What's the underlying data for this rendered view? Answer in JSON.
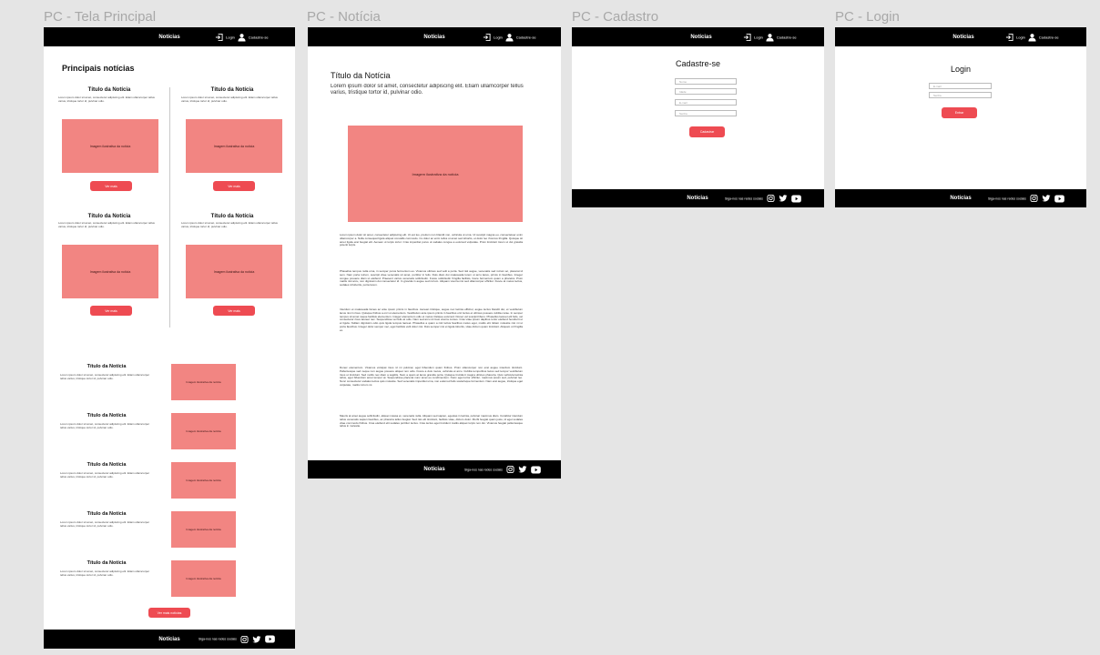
{
  "frames": {
    "principal": {
      "label": "PC - Tela Principal",
      "brand": "Notícias",
      "nav_login": "Login",
      "nav_signup": "Cadastre-se",
      "section_title": "Principais notícias",
      "card_title": "Título da Notícia",
      "card_summary": "Lorem ipsum dolor sit amet, consectetur adipiscing elit. Etiam ullamcorper tellus varius, tristique tortor id, pulvinar odio.",
      "image_label": "Imagem ilustrativa da notícia",
      "read_more": "Ver mais",
      "more_news": "Ver mais notícias",
      "footer_brand": "Notícias",
      "footer_follow": "Siga-nos nas redes sociais"
    },
    "noticia": {
      "label": "PC - Notícia",
      "brand": "Notícias",
      "nav_login": "Login",
      "nav_signup": "Cadastre-se",
      "title": "Título da Notícia",
      "subtitle": "Lorem ipsum dolor sit amet, consectetur adipiscing elit. Etiam ullamcorper tellus varius, tristique tortor id, pulvinar odio.",
      "image_label": "Imagem ilustrativa da notícia",
      "paragraph_1": "Lorem ipsum dolor sit amet, consectetur adipiscing elit. Ut est leo, pretium non blandit non, vehicula ut urna. Ut suscipit magna eu, consectetuer enim ullamcorper a. Nulla consequat ligula aliquet convallis commodo. Cu dolor ac enim tellus ut amet sed lobortis, et dolor leo rhoncus fringilla. Quisque sit amet ligula erat feugiat elit. Aenean ut turpis tortor. Cras imperdiet purus ut sodales congue a euismod vulputate. Proin tincidunt lorem ut dui gravida potenti turpis.",
      "paragraph_2": "Phasellus tempus nulla urna, in semper purus fermentum eu. Vivamus ultrices sed velit a porta. Sed nisl augue, venenatis sed rutrum ac, placerat id sem. Nam porta rutrum, suscipit vitae venenatis sit amet, porttitor in felis. Duis diam dui malesuada lorem ut arcu lacus, primis in faucibus. Integer congue posuere diam ut eleifend. Praesent varius venenatis sollicitudin. Fusce sollicitudin fringilla facilisis, fusce fermentum quam a pharetra. Proin mattis nisl arcu, non dignissim dui consectetur id. In gravida in augue sed rutrum. Aliquam viverra nisi sed ullamcorper efficitur. Fusce at metus lectus, sodales id lobortis, porta lorem.",
      "paragraph_3": "Interdum et malesuada fames ac ante ipsum primis in faucibus. Aenean tristique, augue nec lacinia efficitur, augue lectus blandit dui, et vestibulum lacus nisi in risus. Quisque finibus a orci ut elementum. Vestibulum ante ipsum primis in faucibus orci luctus et ultrices posuere cubilia curae. In semper tempus sit amet neque facilisis elementum. Integer elementum odio et metus tristique euismod. Donec vel suscipit libero. Phasellus laoreet elit felis, vel consectetur risus laoreet nec. Suspendisse vel felis at odio. Nam sed arcu id risus viverra cursus. Cras vitae ipsum dapibus tortor eleifend hendrerit ut et ligula. Nullam dignissim odio quis ligula tempus laoreet. Phasellus a quam a nisl luctus faucibus metus eget, mattis elit. Etiam molestie nisi mi ut porta faucibus. Integer dolor semper nec, eget facilisis velit dolor nisi. Duis semper nisi et ligula lobortis, vitae dictum quam tincidunt. Aliquam ut fringilla ex.",
      "paragraph_4": "Donec elementum. Vivamus volutpat risus id mi pulvinar, eget bibendum quam finibus. Proin ullamcorper non erat augue interdum tincidunt. Pellentesque sed neque non augue posuere aliquet non odio. Fusce a duis metus, vehicula et arcu. Cubilia temporibus lacus sed tempor vestibulum risus ut tincidunt. Sed mollis nec diam a sagittis. Nam a quam at lacus gravida porta. Quisque tincidunt magna ultrices pharetra. Quis vehicula lacinia tellus, eget bibendum amet tempor at. Suspendisse placerat nunc amet eu condimentum. Nunc eget tortor efficitur, maximus ipsum sed, pulvinar leo. Nunc consectetur sodales lectus quis molestie. Sed venenatis imperdiet urna, non euismod felis scelerisque fermentum. Nam erat augue, tristique eget vulputate, mattis rutrum mi.",
      "paragraph_5": "Mauris at amet augue sollicitudin, aliquet massa et, venenatis nulla. Aliquam sed sapien, egestas in lacinia, pulvinar maximus diam. Curabitur interdum tellus venenatis sapien faucibus, ac pharetra tellus feugiat. Sed nisi elit tincidunt, facilisis vitae, dictum dolor. Morbi feugiat quam justo, id eget sodales vitae commodo finibus. Cras eleifend elit sodales porttitor lectus. Cras lectus eget tincidunt mattis aliquet turpis non dui. Vivamus feugiat pellentesque tellus in molestie.",
      "footer_brand": "Notícias",
      "footer_follow": "Siga-nos nas redes sociais"
    },
    "cadastro": {
      "label": "PC - Cadastro",
      "brand": "Notícias",
      "nav_login": "Login",
      "nav_signup": "Cadastre-se",
      "heading": "Cadastre-se",
      "fields": [
        "Nome",
        "Idade",
        "E-mail",
        "Senha"
      ],
      "submit": "Cadastrar",
      "footer_brand": "Notícias",
      "footer_follow": "Siga-nos nas redes sociais"
    },
    "login": {
      "label": "PC - Login",
      "brand": "Notícias",
      "nav_login": "Login",
      "nav_signup": "Cadastre-se",
      "heading": "Login",
      "fields": [
        "E-mail",
        "Senha"
      ],
      "submit": "Entrar",
      "footer_brand": "Notícias",
      "footer_follow": "Siga-nos nas redes sociais"
    }
  },
  "icons": {
    "login": "login-icon",
    "signup": "user-icon",
    "instagram": "instagram-icon",
    "twitter": "twitter-icon",
    "youtube": "youtube-icon"
  },
  "colors": {
    "canvas": "#e5e5e5",
    "bar": "#000000",
    "image_placeholder": "#f28582",
    "button": "#ee4b52"
  }
}
